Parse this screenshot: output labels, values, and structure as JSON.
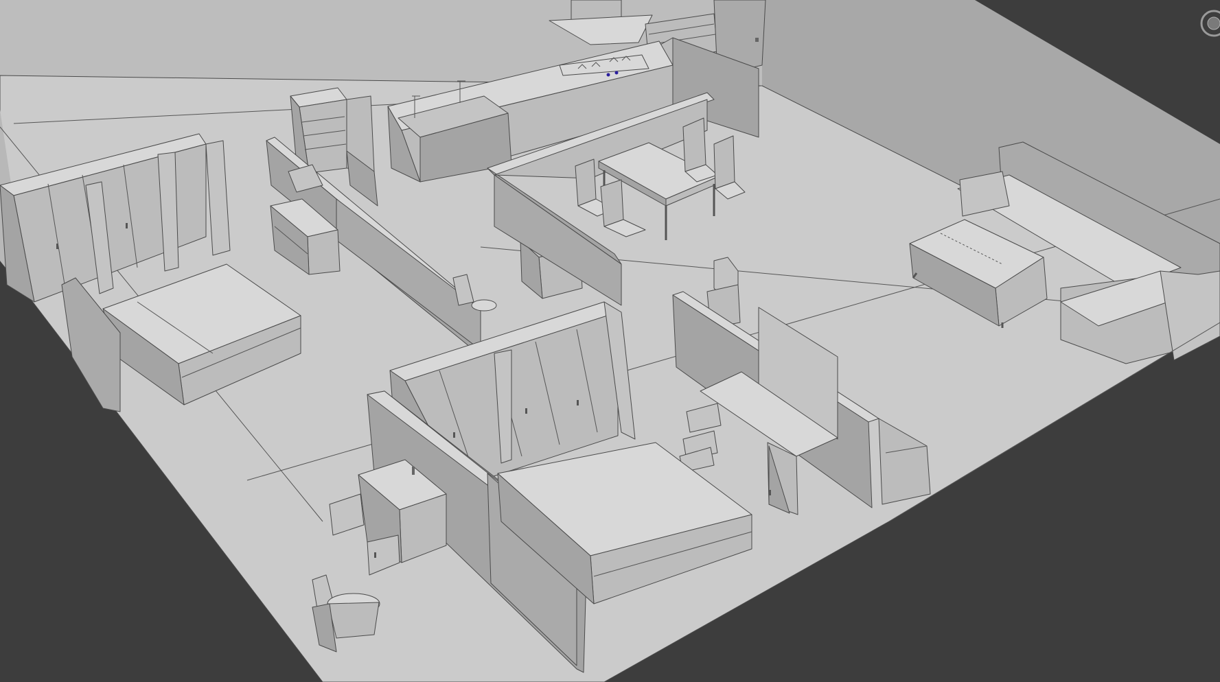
{
  "viewport": {
    "background": "#3d3d3d",
    "floor_color": "#c9c9c9",
    "wall_color": "#a9a9a9",
    "furniture_top": "#d6d6d6",
    "furniture_front": "#b9b9b9",
    "furniture_side": "#a2a2a2",
    "edge_color": "#4a4a4a",
    "highlight_color": "#2b1f9e"
  },
  "viewcube": {
    "icon": "viewcube-icon"
  }
}
